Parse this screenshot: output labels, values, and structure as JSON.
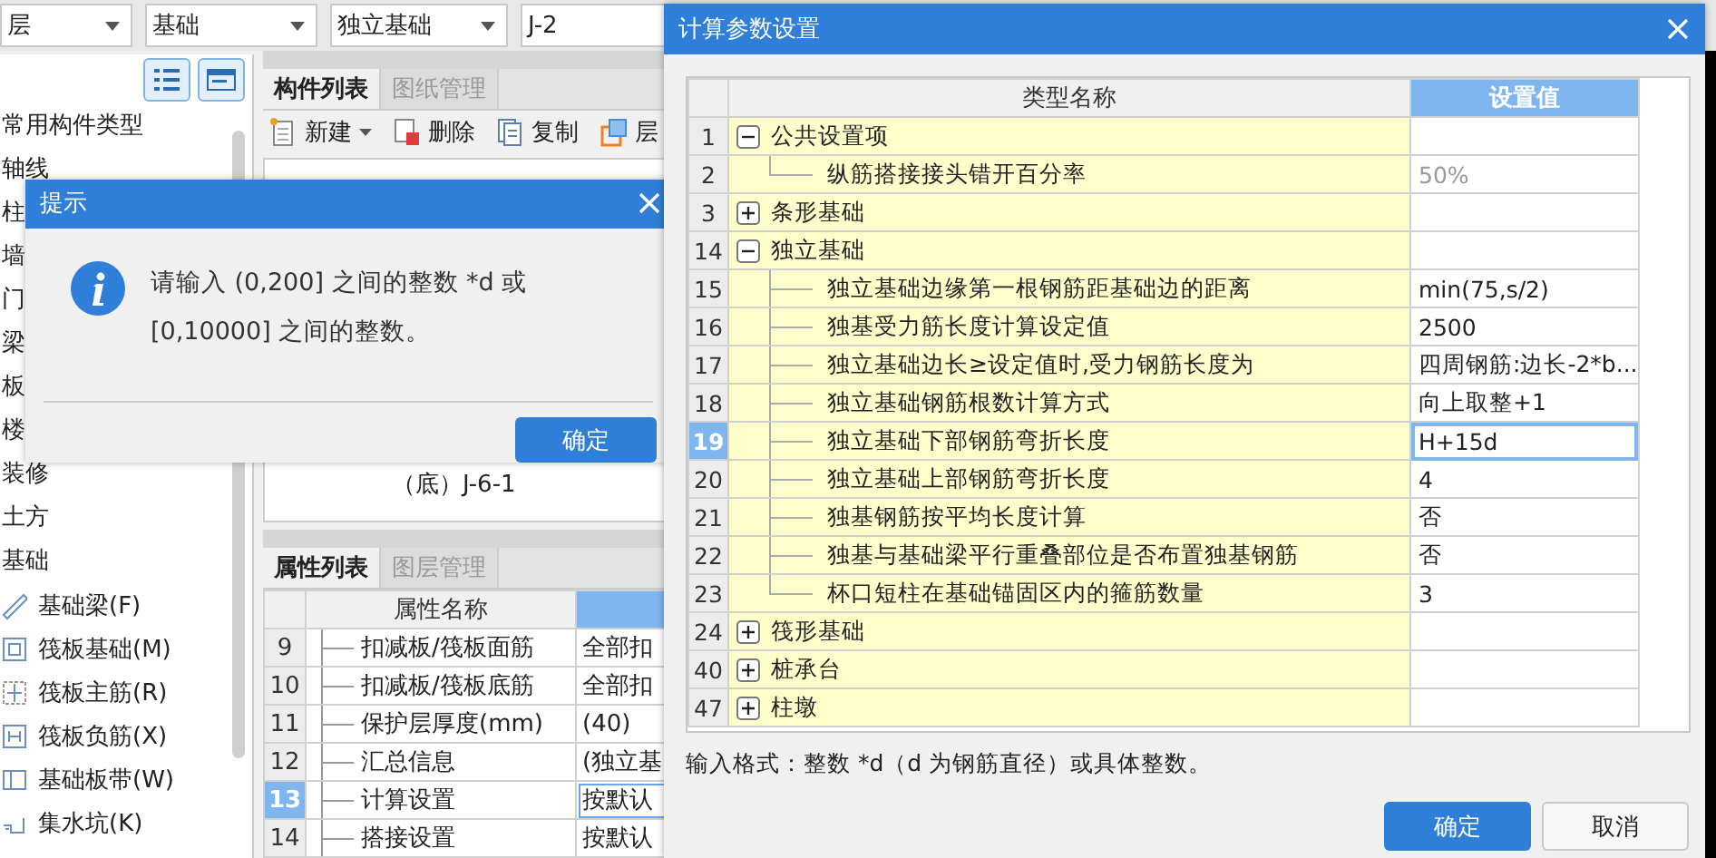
{
  "toolbar": {
    "selectors": [
      {
        "value": "层"
      },
      {
        "value": "基础"
      },
      {
        "value": "独立基础"
      },
      {
        "value": "J-2"
      }
    ]
  },
  "component_tree": {
    "items": [
      {
        "label": "常用构件类型"
      },
      {
        "label": "轴线"
      },
      {
        "label": "柱"
      },
      {
        "label": "墙"
      },
      {
        "label": "门"
      },
      {
        "label": "梁"
      },
      {
        "label": "板"
      },
      {
        "label": "楼"
      },
      {
        "label": "装修"
      },
      {
        "label": "土方"
      },
      {
        "label": "基础",
        "children": [
          {
            "label": "基础梁(F)",
            "kind": "beam"
          },
          {
            "label": "筏板基础(M)",
            "kind": "raft"
          },
          {
            "label": "筏板主筋(R)",
            "kind": "main-bar"
          },
          {
            "label": "筏板负筋(X)",
            "kind": "neg-bar"
          },
          {
            "label": "基础板带(W)",
            "kind": "strip"
          },
          {
            "label": "集水坑(K)",
            "kind": "pit"
          }
        ]
      }
    ]
  },
  "component_list": {
    "tabs": [
      {
        "label": "构件列表",
        "selected": true
      },
      {
        "label": "图纸管理",
        "selected": false
      }
    ],
    "actions": [
      {
        "label": "新建",
        "kind": "new"
      },
      {
        "label": "删除",
        "kind": "delete"
      },
      {
        "label": "复制",
        "kind": "copy"
      },
      {
        "label": "层",
        "kind": "layer"
      }
    ],
    "items": [
      {
        "label": "（底）J-6-1"
      }
    ]
  },
  "property_list": {
    "tabs": [
      {
        "label": "属性列表",
        "selected": true
      },
      {
        "label": "图层管理",
        "selected": false
      }
    ],
    "columns": [
      "属性名称"
    ],
    "rows": [
      {
        "no": "9",
        "name": "扣减板/筏板面筋",
        "value": "全部扣",
        "selected": false
      },
      {
        "no": "10",
        "name": "扣减板/筏板底筋",
        "value": "全部扣",
        "selected": false
      },
      {
        "no": "11",
        "name": "保护层厚度(mm)",
        "value": "(40)",
        "selected": false
      },
      {
        "no": "12",
        "name": "汇总信息",
        "value": "(独立基",
        "selected": false
      },
      {
        "no": "13",
        "name": "计算设置",
        "value": "按默认",
        "selected": true
      },
      {
        "no": "14",
        "name": "搭接设置",
        "value": "按默认",
        "selected": false
      }
    ]
  },
  "hint_dialog": {
    "title": "提示",
    "message": "请输入 (0,200] 之间的整数 *d 或 [0,10000] 之间的整数。",
    "buttons": [
      "确定"
    ]
  },
  "settings_dialog": {
    "title": "计算参数设置",
    "columns": [
      "类型名称",
      "设置值"
    ],
    "rows": [
      {
        "no": "1",
        "kind": "group",
        "expanded": true,
        "name": "公共设置项",
        "selected": false
      },
      {
        "no": "2",
        "kind": "item",
        "name": "纵筋搭接接头错开百分率",
        "value": "50%",
        "disabled": true,
        "selected": false
      },
      {
        "no": "3",
        "kind": "group",
        "expanded": false,
        "name": "条形基础",
        "selected": false
      },
      {
        "no": "14",
        "kind": "group",
        "expanded": true,
        "name": "独立基础",
        "selected": false
      },
      {
        "no": "15",
        "kind": "item",
        "name": "独立基础边缘第一根钢筋距基础边的距离",
        "value": "min(75,s/2)",
        "disabled": false,
        "selected": false
      },
      {
        "no": "16",
        "kind": "item",
        "name": "独基受力筋长度计算设定值",
        "value": "2500",
        "disabled": false,
        "selected": false
      },
      {
        "no": "17",
        "kind": "item",
        "name": "独立基础边长≥设定值时,受力钢筋长度为",
        "value": "四周钢筋:边长-2*b...",
        "disabled": false,
        "selected": false
      },
      {
        "no": "18",
        "kind": "item",
        "name": "独立基础钢筋根数计算方式",
        "value": "向上取整+1",
        "disabled": false,
        "selected": false
      },
      {
        "no": "19",
        "kind": "item",
        "name": "独立基础下部钢筋弯折长度",
        "value": "H+15d",
        "disabled": false,
        "selected": true
      },
      {
        "no": "20",
        "kind": "item",
        "name": "独立基础上部钢筋弯折长度",
        "value": "4",
        "disabled": false,
        "selected": false
      },
      {
        "no": "21",
        "kind": "item",
        "name": "独基钢筋按平均长度计算",
        "value": "否",
        "disabled": false,
        "selected": false
      },
      {
        "no": "22",
        "kind": "item",
        "name": "独基与基础梁平行重叠部位是否布置独基钢筋",
        "value": "否",
        "disabled": false,
        "selected": false
      },
      {
        "no": "23",
        "kind": "item",
        "name": "杯口短柱在基础锚固区内的箍筋数量",
        "value": "3",
        "disabled": false,
        "selected": false
      },
      {
        "no": "24",
        "kind": "group",
        "expanded": false,
        "name": "筏形基础",
        "selected": false
      },
      {
        "no": "40",
        "kind": "group",
        "expanded": false,
        "name": "桩承台",
        "selected": false
      },
      {
        "no": "47",
        "kind": "group",
        "expanded": false,
        "name": "柱墩",
        "selected": false
      }
    ],
    "hint": "输入格式：整数 *d（d 为钢筋直径）或具体整数。",
    "buttons": [
      {
        "label": "确定",
        "primary": true
      },
      {
        "label": "取消",
        "primary": false
      }
    ]
  }
}
